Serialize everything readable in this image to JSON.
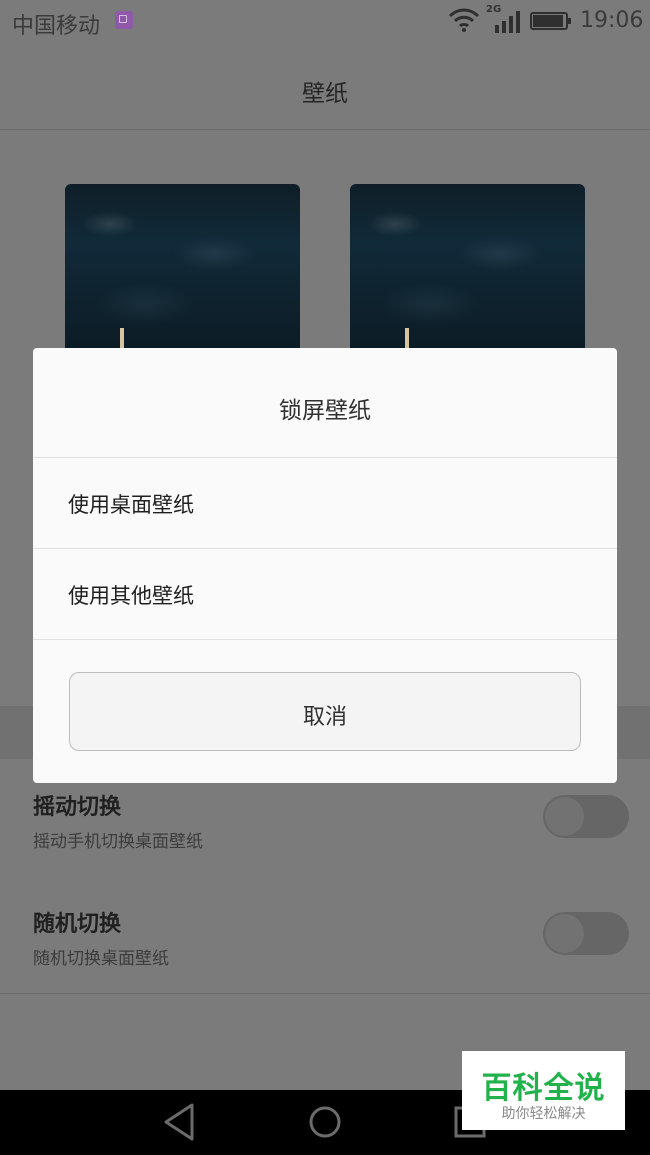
{
  "status_bar": {
    "carrier": "中国移动",
    "network": "2G",
    "time": "19:06"
  },
  "header": {
    "title": "壁纸"
  },
  "settings": {
    "items": [
      {
        "title": "摇动切换",
        "description": "摇动手机切换桌面壁纸",
        "enabled": false
      },
      {
        "title": "随机切换",
        "description": "随机切换桌面壁纸",
        "enabled": false
      }
    ]
  },
  "dialog": {
    "title": "锁屏壁纸",
    "options": [
      "使用桌面壁纸",
      "使用其他壁纸"
    ],
    "cancel_label": "取消"
  },
  "watermark": {
    "title": "百科全说",
    "subtitle": "助你轻松解决"
  },
  "colors": {
    "dim_background": "#7b7b7b",
    "dialog_background": "#fafafa",
    "watermark_green": "#22b24c"
  },
  "icons": {
    "status": [
      "sim-icon",
      "wifi-icon",
      "signal-icon",
      "battery-icon"
    ],
    "navigation": [
      "back-icon",
      "home-icon",
      "recent-apps-icon"
    ]
  }
}
